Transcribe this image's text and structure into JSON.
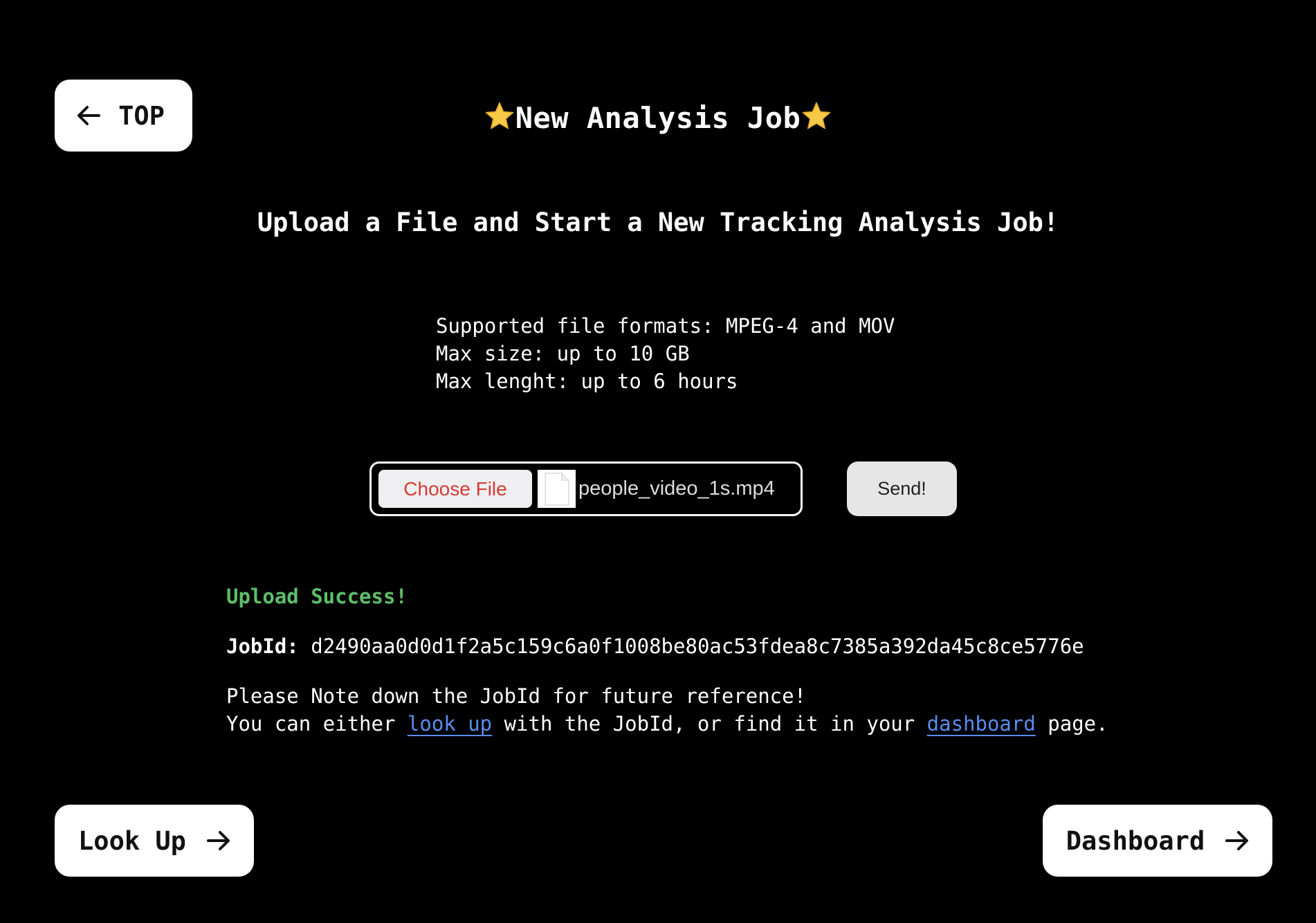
{
  "nav": {
    "top_label": "TOP",
    "lookup_label": "Look Up",
    "dashboard_label": "Dashboard"
  },
  "header": {
    "title": "New Analysis Job",
    "subtitle": "Upload a File and Start a New Tracking Analysis Job!"
  },
  "info": {
    "formats": "Supported file formats: MPEG-4 and MOV",
    "max_size": "Max size: up to 10 GB",
    "max_length": "Max lenght: up to 6 hours"
  },
  "upload": {
    "choose_label": "Choose File",
    "file_name": "people_video_1s.mp4",
    "send_label": "Send!"
  },
  "result": {
    "status": "Upload Success!",
    "jobid_label": "JobId:",
    "jobid_value": "d2490aa0d0d1f2a5c159c6a0f1008be80ac53fdea8c7385a392da45c8ce5776e",
    "note_line1": "Please Note down the JobId for future reference!",
    "note_line2_pre": "You can either ",
    "note_link_lookup": "look up",
    "note_line2_mid": " with the JobId, or find it in your ",
    "note_link_dashboard": "dashboard",
    "note_line2_post": " page."
  },
  "colors": {
    "background": "#000000",
    "success": "#5cbf6a",
    "link": "#5b8def",
    "choose_file_text": "#d63b34"
  }
}
